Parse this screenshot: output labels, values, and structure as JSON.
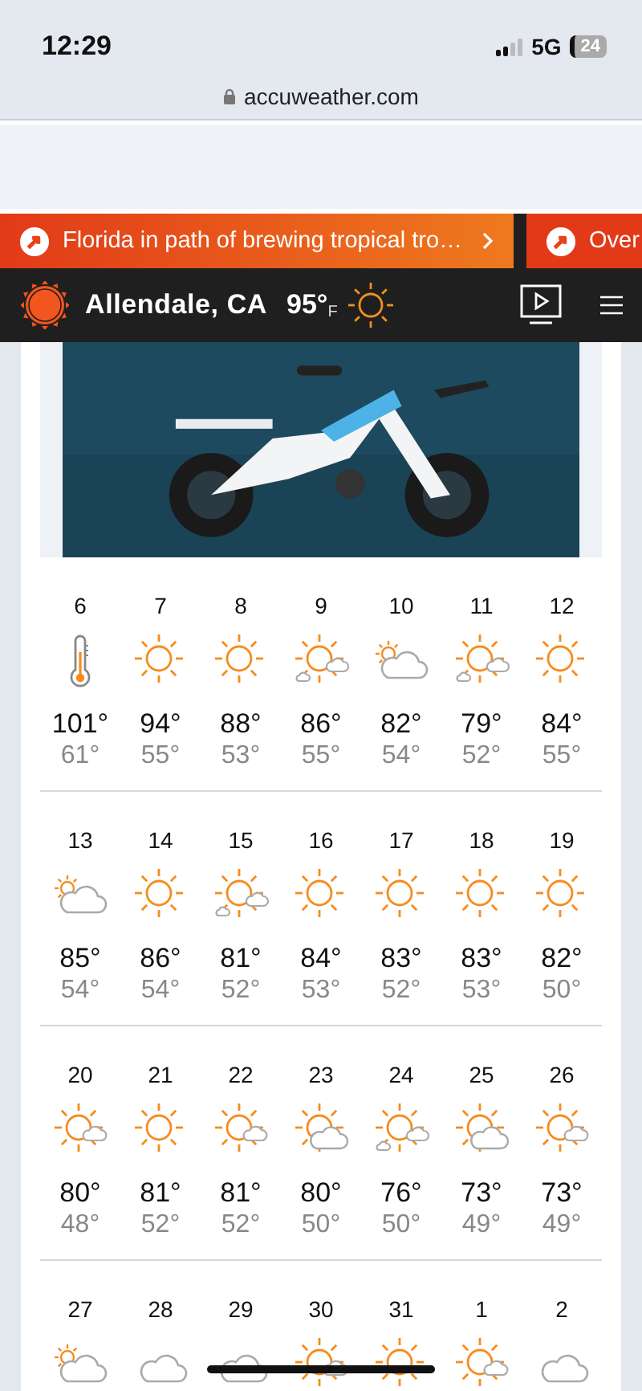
{
  "status_bar": {
    "time": "12:29",
    "network": "5G",
    "battery": "24"
  },
  "address_bar": {
    "url": "accuweather.com"
  },
  "news_ticker": [
    {
      "headline": "Florida in path of brewing tropical tro…"
    },
    {
      "headline": "Over"
    }
  ],
  "header": {
    "location": "Allendale, CA",
    "temperature": "95°",
    "unit": "F"
  },
  "calendar": {
    "weeks": [
      [
        {
          "date": "6",
          "kind": "thermometer",
          "high": "101°",
          "low": "61°"
        },
        {
          "date": "7",
          "kind": "sunny",
          "high": "94°",
          "low": "55°"
        },
        {
          "date": "8",
          "kind": "sunny",
          "high": "88°",
          "low": "53°"
        },
        {
          "date": "9",
          "kind": "partly_sunny",
          "high": "86°",
          "low": "55°"
        },
        {
          "date": "10",
          "kind": "mostly_cloudy",
          "high": "82°",
          "low": "54°"
        },
        {
          "date": "11",
          "kind": "partly_sunny",
          "high": "79°",
          "low": "52°"
        },
        {
          "date": "12",
          "kind": "sunny",
          "high": "84°",
          "low": "55°"
        }
      ],
      [
        {
          "date": "13",
          "kind": "mostly_cloudy",
          "high": "85°",
          "low": "54°"
        },
        {
          "date": "14",
          "kind": "sunny",
          "high": "86°",
          "low": "54°"
        },
        {
          "date": "15",
          "kind": "partly_sunny",
          "high": "81°",
          "low": "52°"
        },
        {
          "date": "16",
          "kind": "sunny",
          "high": "84°",
          "low": "53°"
        },
        {
          "date": "17",
          "kind": "sunny",
          "high": "83°",
          "low": "52°"
        },
        {
          "date": "18",
          "kind": "sunny",
          "high": "83°",
          "low": "53°"
        },
        {
          "date": "19",
          "kind": "sunny",
          "high": "82°",
          "low": "50°"
        }
      ],
      [
        {
          "date": "20",
          "kind": "mostly_sunny",
          "high": "80°",
          "low": "48°"
        },
        {
          "date": "21",
          "kind": "sunny",
          "high": "81°",
          "low": "52°"
        },
        {
          "date": "22",
          "kind": "mostly_sunny",
          "high": "81°",
          "low": "52°"
        },
        {
          "date": "23",
          "kind": "partly_cloudy",
          "high": "80°",
          "low": "50°"
        },
        {
          "date": "24",
          "kind": "partly_sunny",
          "high": "76°",
          "low": "50°"
        },
        {
          "date": "25",
          "kind": "partly_cloudy",
          "high": "73°",
          "low": "49°"
        },
        {
          "date": "26",
          "kind": "mostly_sunny",
          "high": "73°",
          "low": "49°"
        }
      ],
      [
        {
          "date": "27",
          "kind": "mostly_cloudy"
        },
        {
          "date": "28",
          "kind": "cloudy"
        },
        {
          "date": "29",
          "kind": "cloudy"
        },
        {
          "date": "30",
          "kind": "mostly_sunny"
        },
        {
          "date": "31",
          "kind": "sunny"
        },
        {
          "date": "1",
          "kind": "mostly_sunny"
        },
        {
          "date": "2",
          "kind": "cloudy"
        }
      ]
    ]
  }
}
